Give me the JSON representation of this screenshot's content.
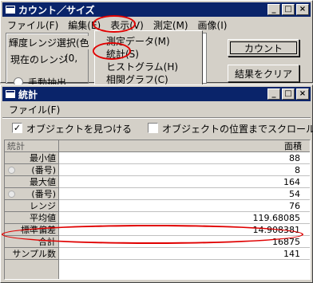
{
  "back_window": {
    "title": "カウント／サイズ",
    "menu": [
      "ファイル(F)",
      "編集(E)",
      "表示(V)",
      "測定(M)",
      "画像(I)"
    ],
    "range_group_label": "輝度レンジ選択(色",
    "current_range_label": "現在のレンジ",
    "current_range_value": "(0,",
    "manual_extract_label": "手動抽出",
    "count_button": "カウント",
    "clear_results_button": "結果をクリア",
    "view_menu_items": [
      "測定データ(M)",
      "統計(S)",
      "ヒストグラム(H)",
      "相関グラフ(C)"
    ]
  },
  "title_buttons": [
    "_",
    "□",
    "×"
  ],
  "stats_window": {
    "title": "統計",
    "menu": [
      "ファイル(F)"
    ],
    "find_objects_checkbox": {
      "label": "オブジェクトを見つける",
      "checked": true,
      "mark": "✓"
    },
    "scroll_checkbox": {
      "label": "オブジェクトの位置までスクロール",
      "checked": false
    },
    "table": {
      "header": {
        "label": "統計",
        "column": "面積"
      },
      "rows": [
        {
          "label": "最小値",
          "value": "88"
        },
        {
          "label": "(番号)",
          "value": "8"
        },
        {
          "label": "最大値",
          "value": "164"
        },
        {
          "label": "(番号)",
          "value": "54"
        },
        {
          "label": "レンジ",
          "value": "76"
        },
        {
          "label": "平均値",
          "value": "119.68085"
        },
        {
          "label": "標準偏差",
          "value": "14.908381"
        },
        {
          "label": "合計",
          "value": "16875"
        },
        {
          "label": "サンプル数",
          "value": "141"
        }
      ]
    }
  },
  "colors": {
    "titlebar": "#0a246a",
    "highlight_ellipse": "#e00000"
  }
}
